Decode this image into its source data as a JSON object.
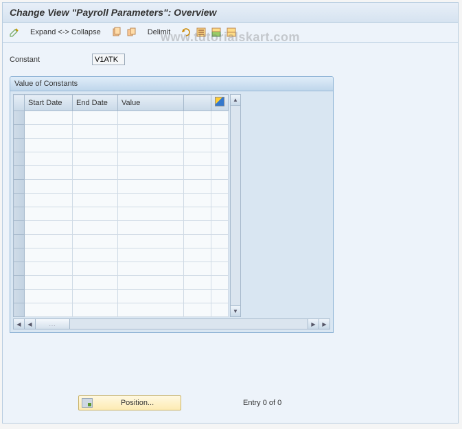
{
  "title": "Change View \"Payroll Parameters\": Overview",
  "toolbar": {
    "expand_collapse": "Expand <-> Collapse",
    "delimit": "Delimit"
  },
  "field": {
    "label": "Constant",
    "value": "V1ATK"
  },
  "panel": {
    "title": "Value of Constants",
    "columns": {
      "start": "Start Date",
      "end": "End Date",
      "value": "Value"
    },
    "row_count": 15
  },
  "footer": {
    "position_label": "Position...",
    "entry_text": "Entry 0 of 0"
  },
  "watermark": "www.tutorialskart.com",
  "hscroll_thumb": "..."
}
